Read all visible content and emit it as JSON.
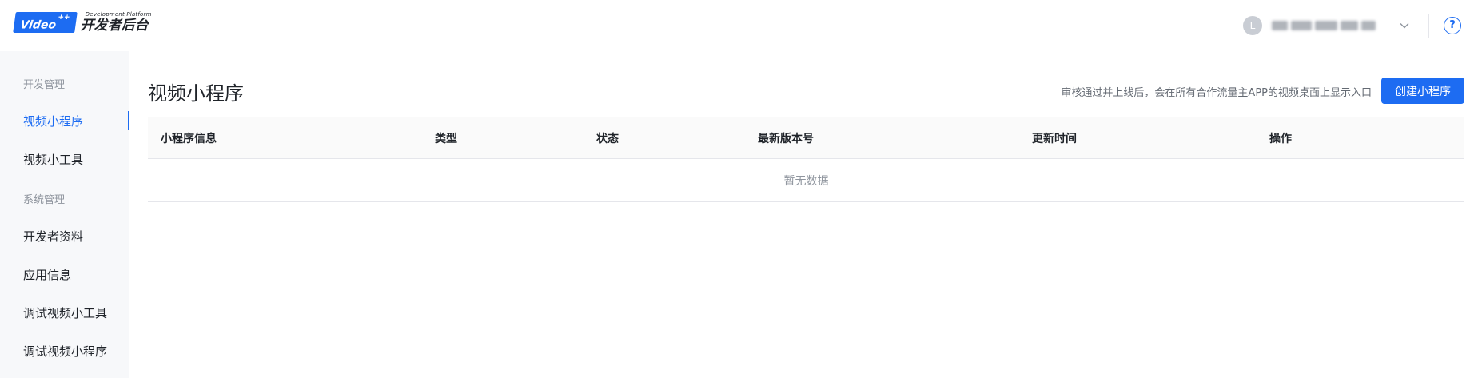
{
  "header": {
    "logo_badge": "Video",
    "logo_badge_sup": "++",
    "logo_sub": "Development Platform",
    "logo_main": "开发者后台",
    "avatar_initial": "L",
    "help_symbol": "?",
    "accent_color": "#1d6cf2"
  },
  "sidebar": {
    "groups": [
      {
        "title": "开发管理",
        "items": [
          "视频小程序",
          "视频小工具"
        ]
      },
      {
        "title": "系统管理",
        "items": [
          "开发者资料",
          "应用信息",
          "调试视频小工具",
          "调试视频小程序"
        ]
      }
    ],
    "active_item": "视频小程序"
  },
  "main": {
    "title": "视频小程序",
    "hint": "审核通过并上线后，会在所有合作流量主APP的视频桌面上显示入口",
    "create_button": "创建小程序",
    "table": {
      "columns": [
        "小程序信息",
        "类型",
        "状态",
        "最新版本号",
        "更新时间",
        "操作"
      ],
      "empty_text": "暂无数据"
    }
  }
}
